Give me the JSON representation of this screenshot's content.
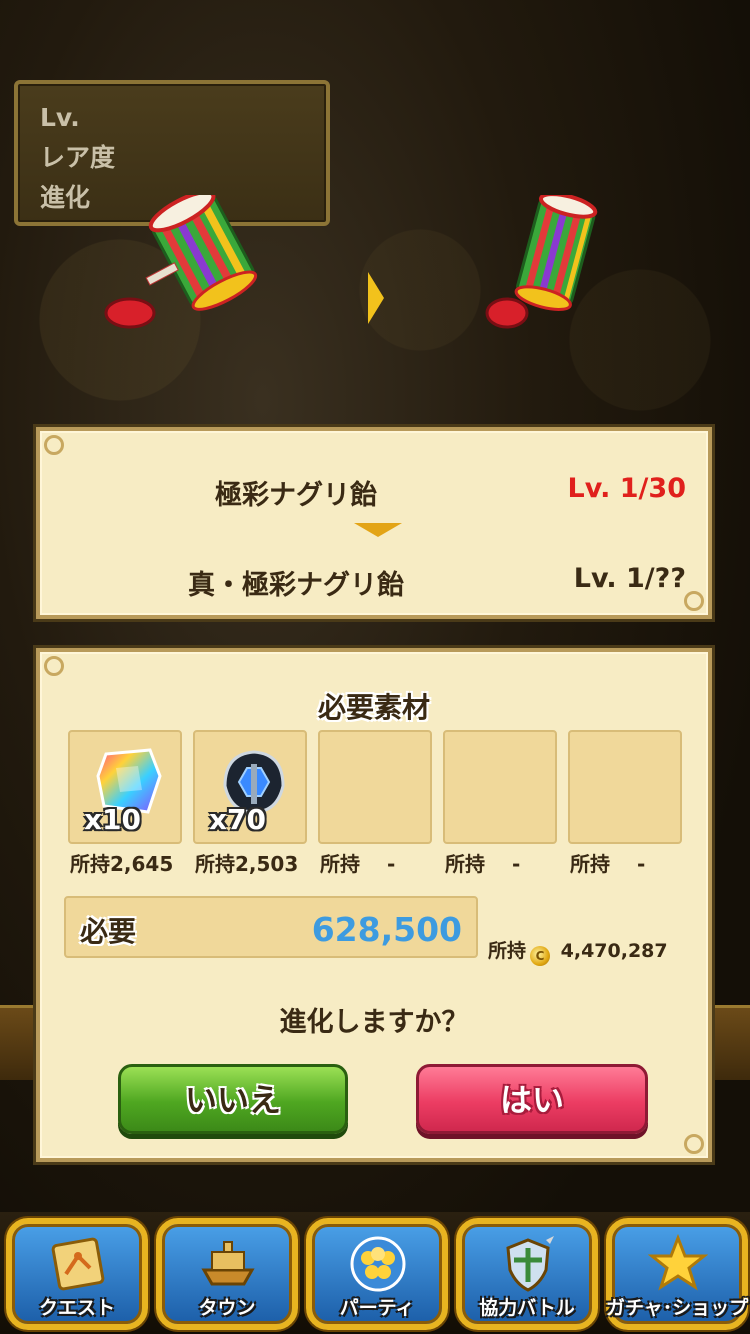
{
  "stats_panel": {
    "lines": [
      "Lv.",
      "レア度",
      "進化"
    ]
  },
  "evolution": {
    "from_name": "極彩ナグリ飴",
    "from_level": "Lv. 1/30",
    "to_name": "真・極彩ナグリ飴",
    "to_level": "Lv. 1/??",
    "from_level_color": "#e0201c"
  },
  "materials": {
    "title": "必要素材",
    "slots": [
      {
        "icon": "rainbow-crystal-icon",
        "qty": "x10",
        "owned": "所持2,645"
      },
      {
        "icon": "blue-axe-orb-icon",
        "qty": "x70",
        "owned": "所持2,503"
      },
      {
        "icon": "",
        "qty": "",
        "owned": "所持　 -"
      },
      {
        "icon": "",
        "qty": "",
        "owned": "所持　 -"
      },
      {
        "icon": "",
        "qty": "",
        "owned": "所持　 -"
      }
    ],
    "cost_label": "必要",
    "cost_value": "628,500",
    "coins_owned_label": "所持",
    "coins_owned_value": "4,470,287",
    "confirm_text": "進化しますか？",
    "btn_no": "いいえ",
    "btn_yes": "はい"
  },
  "nav": {
    "items": [
      {
        "label": "クエスト",
        "icon": "quest-map-icon"
      },
      {
        "label": "タウン",
        "icon": "town-ship-icon"
      },
      {
        "label": "パーティ",
        "icon": "party-icon"
      },
      {
        "label": "協力バトル",
        "icon": "shield-swords-icon"
      },
      {
        "label": "ガチャ･ショップ",
        "icon": "star-icon"
      }
    ]
  },
  "colors": {
    "parchment": "#f7ecc4",
    "cost_blue": "#3d9be0",
    "yes_red": "#ec3d63",
    "no_green": "#4fa721",
    "nav_gold": "#e8b420"
  }
}
